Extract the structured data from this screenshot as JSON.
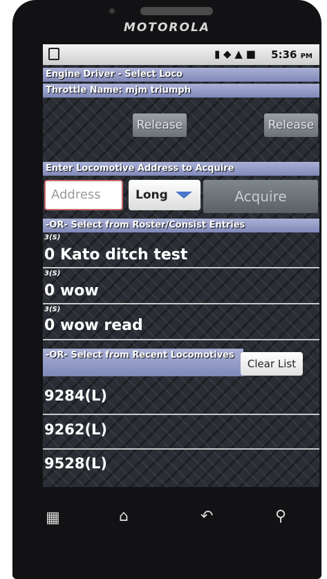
{
  "device": {
    "brand": "MOTOROLA"
  },
  "status_bar": {
    "time": "5:36",
    "ampm": "PM"
  },
  "app": {
    "title": "Engine Driver - Select Loco",
    "throttle_name": "Throttle Name: mjm triumph",
    "release_left": "Release",
    "release_right": "Release",
    "enter_address_header": "Enter Locomotive Address to Acquire",
    "address_placeholder": "Address",
    "address_type": "Long",
    "acquire_label": "Acquire",
    "roster_header": "-OR- Select from Roster/Consist Entries",
    "roster": [
      {
        "tag": "3(S)",
        "name": "0 Kato ditch test"
      },
      {
        "tag": "3(S)",
        "name": "0 wow"
      },
      {
        "tag": "3(S)",
        "name": "0 wow read"
      }
    ],
    "recent_header": "-OR- Select from Recent Locomotives",
    "clear_list": "Clear List",
    "recent": [
      "9284(L)",
      "9262(L)",
      "9528(L)"
    ]
  },
  "nav_icons": [
    "apps-icon",
    "home-icon",
    "back-icon",
    "search-icon"
  ]
}
